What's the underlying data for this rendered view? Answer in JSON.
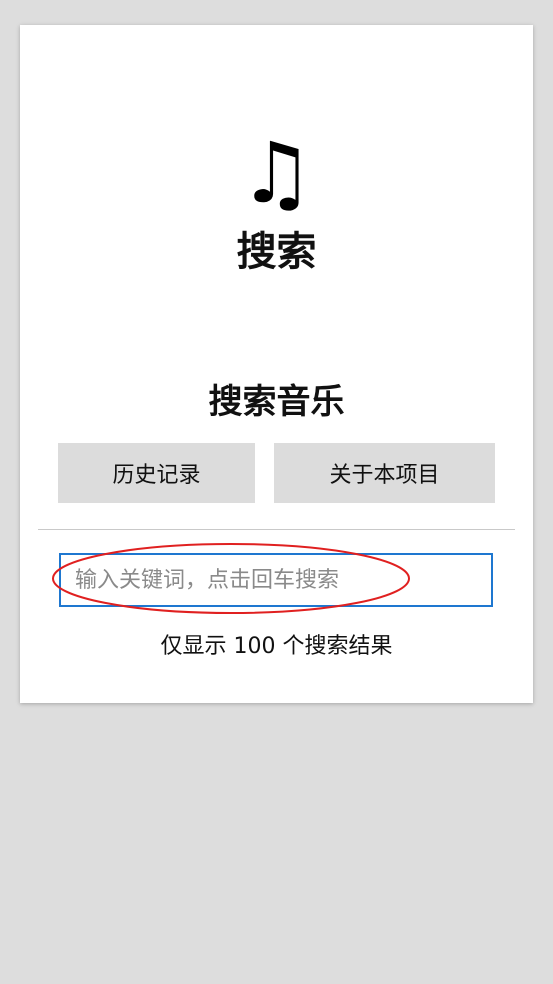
{
  "header": {
    "logo_icon": "♫",
    "logo_icon_name": "music-note-icon",
    "title": "搜索"
  },
  "main": {
    "section_title": "搜索音乐",
    "buttons": {
      "history_label": "历史记录",
      "about_label": "关于本项目"
    },
    "search": {
      "placeholder": "输入关键词，点击回车搜索",
      "value": ""
    },
    "hint": "仅显示 100 个搜索结果"
  },
  "colors": {
    "page_background": "#dddddd",
    "card_background": "#ffffff",
    "button_background": "#dcdcdc",
    "input_border": "#1e77d0",
    "annotation": "#e02020"
  }
}
